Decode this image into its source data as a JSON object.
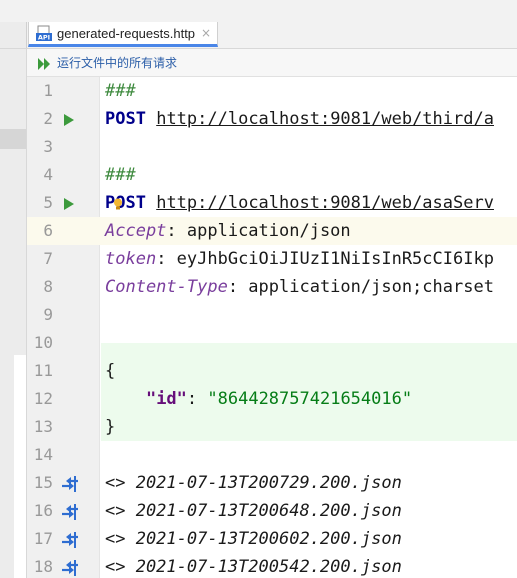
{
  "tab": {
    "title": "generated-requests.http",
    "close_glyph": "×",
    "icon": "api-file-icon"
  },
  "toolbar": {
    "run_all_label": "运行文件中的所有请求",
    "icon": "run-all-icon"
  },
  "colors": {
    "run_green": "#3c9a3c",
    "ref_blue": "#2e6dd1",
    "tab_underline": "#4a86e8"
  },
  "editor": {
    "lines": [
      {
        "num": "1",
        "gutter_icon": "",
        "tokens": [
          {
            "t": "###",
            "c": "comment"
          }
        ]
      },
      {
        "num": "2",
        "gutter_icon": "run-icon",
        "tokens": [
          {
            "t": "POST",
            "c": "kw"
          },
          {
            "t": " ",
            "c": ""
          },
          {
            "t": "http://localhost:9081/web/third/a",
            "c": "url"
          }
        ]
      },
      {
        "num": "3",
        "gutter_icon": "",
        "tokens": []
      },
      {
        "num": "4",
        "gutter_icon": "",
        "tokens": [
          {
            "t": "###",
            "c": "comment"
          }
        ]
      },
      {
        "num": "5",
        "gutter_icon": "run-icon",
        "tokens": [
          {
            "t": "POST",
            "c": "kw"
          },
          {
            "t": " ",
            "c": ""
          },
          {
            "t": "http://localhost:9081/web/asaServ",
            "c": "url"
          }
        ]
      },
      {
        "num": "6",
        "gutter_icon": "",
        "tokens": [
          {
            "t": "Accept",
            "c": "hname"
          },
          {
            "t": ": application/json",
            "c": "hval"
          }
        ]
      },
      {
        "num": "7",
        "gutter_icon": "",
        "tokens": [
          {
            "t": "token",
            "c": "hname"
          },
          {
            "t": ": eyJhbGciOiJIUzI1NiIsInR5cCI6Ikp",
            "c": "hval"
          }
        ]
      },
      {
        "num": "8",
        "gutter_icon": "",
        "tokens": [
          {
            "t": "Content-Type",
            "c": "hname"
          },
          {
            "t": ": application/json;charset",
            "c": "hval"
          }
        ]
      },
      {
        "num": "9",
        "gutter_icon": "",
        "tokens": []
      },
      {
        "num": "10",
        "gutter_icon": "",
        "tokens": []
      },
      {
        "num": "11",
        "gutter_icon": "",
        "tokens": [
          {
            "t": "{",
            "c": "hval"
          }
        ]
      },
      {
        "num": "12",
        "gutter_icon": "",
        "tokens": [
          {
            "t": "    ",
            "c": ""
          },
          {
            "t": "\"id\"",
            "c": "jkey"
          },
          {
            "t": ": ",
            "c": "hval"
          },
          {
            "t": "\"864428757421654016\"",
            "c": "jstr"
          }
        ]
      },
      {
        "num": "13",
        "gutter_icon": "",
        "tokens": [
          {
            "t": "}",
            "c": "hval"
          }
        ]
      },
      {
        "num": "14",
        "gutter_icon": "",
        "tokens": []
      },
      {
        "num": "15",
        "gutter_icon": "response-ref-icon",
        "tokens": [
          {
            "t": "<> 2021-07-13T200729.200.json",
            "c": "ref"
          }
        ]
      },
      {
        "num": "16",
        "gutter_icon": "response-ref-icon",
        "tokens": [
          {
            "t": "<> 2021-07-13T200648.200.json",
            "c": "ref"
          }
        ]
      },
      {
        "num": "17",
        "gutter_icon": "response-ref-icon",
        "tokens": [
          {
            "t": "<> 2021-07-13T200602.200.json",
            "c": "ref"
          }
        ]
      },
      {
        "num": "18",
        "gutter_icon": "response-ref-icon",
        "tokens": [
          {
            "t": "<> 2021-07-13T200542.200.json",
            "c": "ref"
          }
        ]
      }
    ]
  }
}
